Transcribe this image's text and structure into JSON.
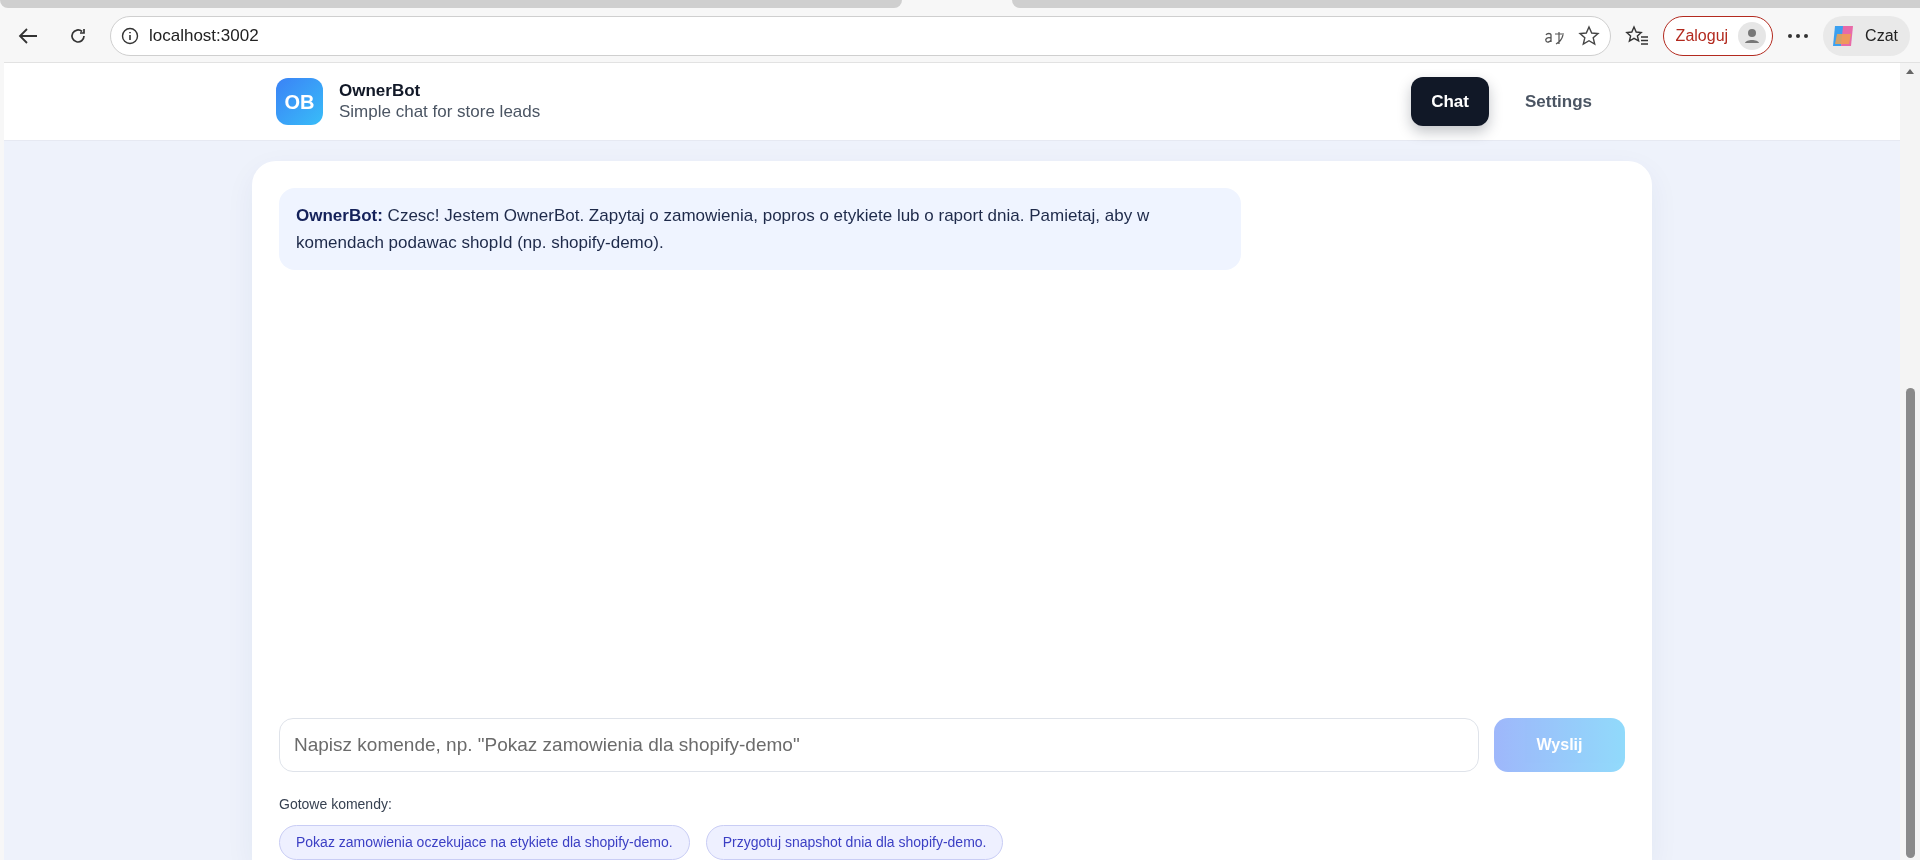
{
  "browser": {
    "url": "localhost:3002",
    "login_button": "Zaloguj",
    "copilot_button": "Czat"
  },
  "header": {
    "logo": "OB",
    "title": "OwnerBot",
    "subtitle": "Simple chat for store leads",
    "nav": [
      {
        "label": "Chat",
        "selected": true
      },
      {
        "label": "Settings",
        "selected": false
      }
    ]
  },
  "messages": [
    {
      "sender": "OwnerBot:",
      "text": "Czesc! Jestem OwnerBot. Zapytaj o zamowienia, popros o etykiete lub o raport dnia. Pamietaj, aby w komendach podawac shopId (np. shopify-demo)."
    }
  ],
  "composer": {
    "placeholder": "Napisz komende, np. \"Pokaz zamowienia dla shopify-demo\"",
    "send_button": "Wyslij",
    "disabled": true
  },
  "quick_commands": {
    "label": "Gotowe komendy:",
    "items": [
      "Pokaz zamowienia oczekujace na etykiete dla shopify-demo.",
      "Przygotuj snapshot dnia dla shopify-demo."
    ]
  }
}
